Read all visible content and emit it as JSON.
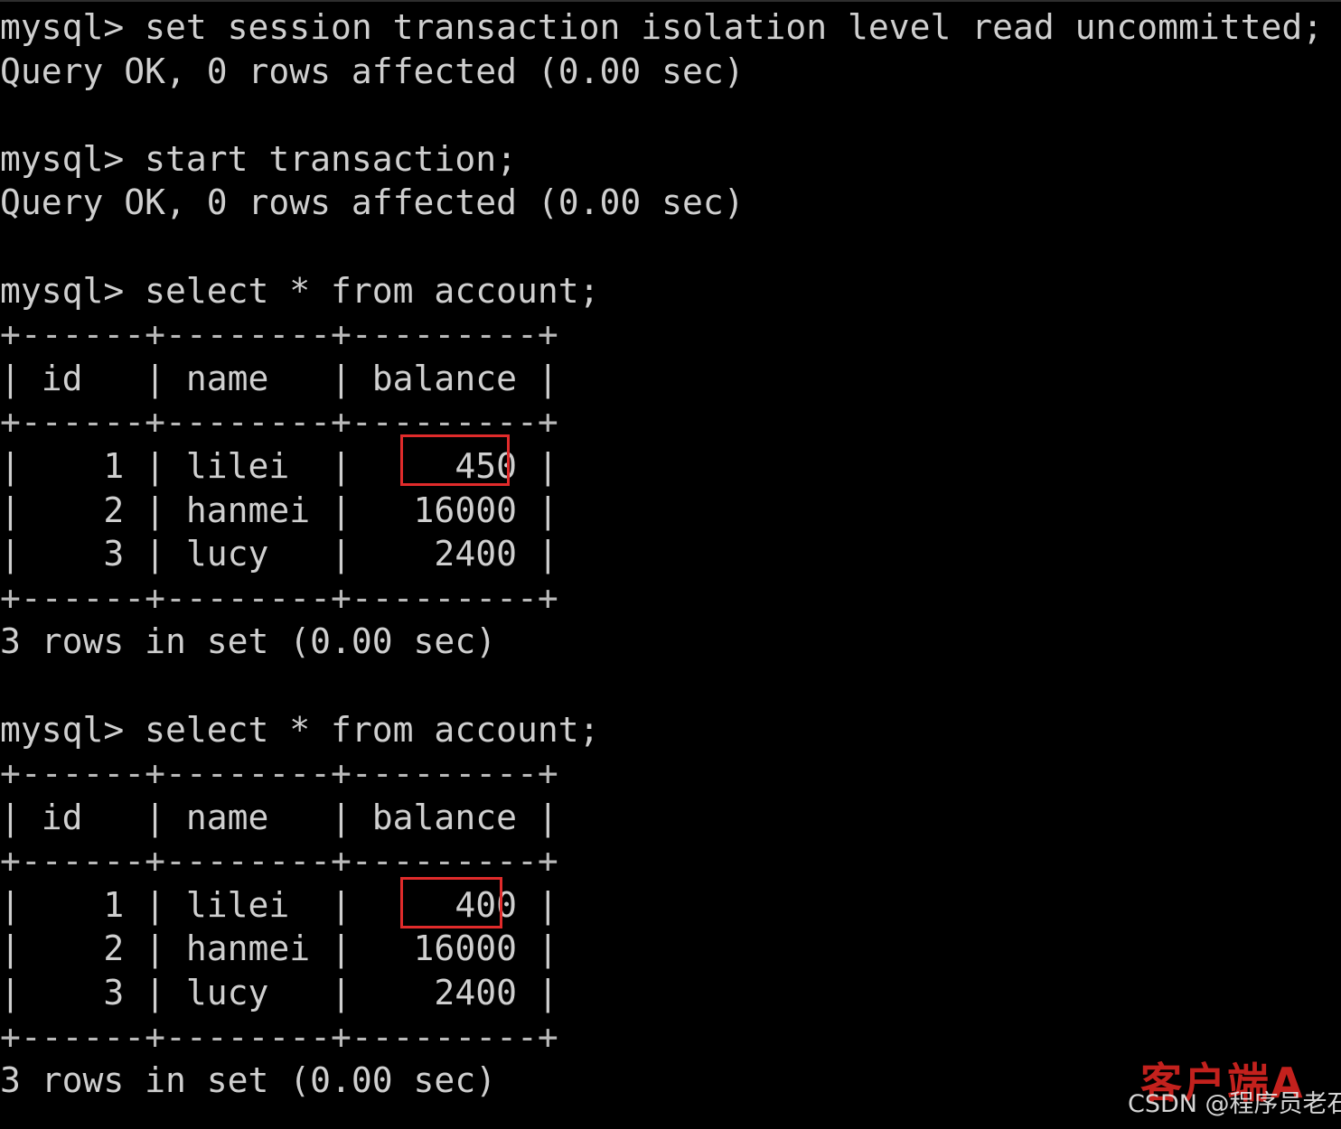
{
  "terminal": {
    "prompt": "mysql>",
    "background_color": "#000000",
    "text_color": "#cfcfcf",
    "highlight_color": "#e02b2b",
    "lines": [
      "mysql> set session transaction isolation level read uncommitted;",
      "Query OK, 0 rows affected (0.00 sec)",
      "",
      "mysql> start transaction;",
      "Query OK, 0 rows affected (0.00 sec)",
      "",
      "mysql> select * from account;",
      "+------+--------+---------+",
      "| id   | name   | balance |",
      "+------+--------+---------+",
      "|    1 | lilei  |     450 |",
      "|    2 | hanmei |   16000 |",
      "|    3 | lucy   |    2400 |",
      "+------+--------+---------+",
      "3 rows in set (0.00 sec)",
      "",
      "mysql> select * from account;",
      "+------+--------+---------+",
      "| id   | name   | balance |",
      "+------+--------+---------+",
      "|    1 | lilei  |     400 |",
      "|    2 | hanmei |   16000 |",
      "|    3 | lucy   |    2400 |",
      "+------+--------+---------+",
      "3 rows in set (0.00 sec)"
    ]
  },
  "commands": [
    {
      "statement": "set session transaction isolation level read uncommitted;",
      "result": "Query OK, 0 rows affected (0.00 sec)"
    },
    {
      "statement": "start transaction;",
      "result": "Query OK, 0 rows affected (0.00 sec)"
    },
    {
      "statement": "select * from account;",
      "result": "3 rows in set (0.00 sec)"
    },
    {
      "statement": "select * from account;",
      "result": "3 rows in set (0.00 sec)"
    }
  ],
  "tables": [
    {
      "columns": [
        "id",
        "name",
        "balance"
      ],
      "rows": [
        [
          "1",
          "lilei",
          "450"
        ],
        [
          "2",
          "hanmei",
          "16000"
        ],
        [
          "3",
          "lucy",
          "2400"
        ]
      ],
      "highlighted_cell": "450",
      "footer": "3 rows in set (0.00 sec)"
    },
    {
      "columns": [
        "id",
        "name",
        "balance"
      ],
      "rows": [
        [
          "1",
          "lilei",
          "400"
        ],
        [
          "2",
          "hanmei",
          "16000"
        ],
        [
          "3",
          "lucy",
          "2400"
        ]
      ],
      "highlighted_cell": "400",
      "footer": "3 rows in set (0.00 sec)"
    }
  ],
  "watermark": {
    "client_label": "客户端A",
    "credit": "CSDN @程序员老石",
    "client_color": "#c3211d",
    "credit_color": "#e8e8e8"
  }
}
